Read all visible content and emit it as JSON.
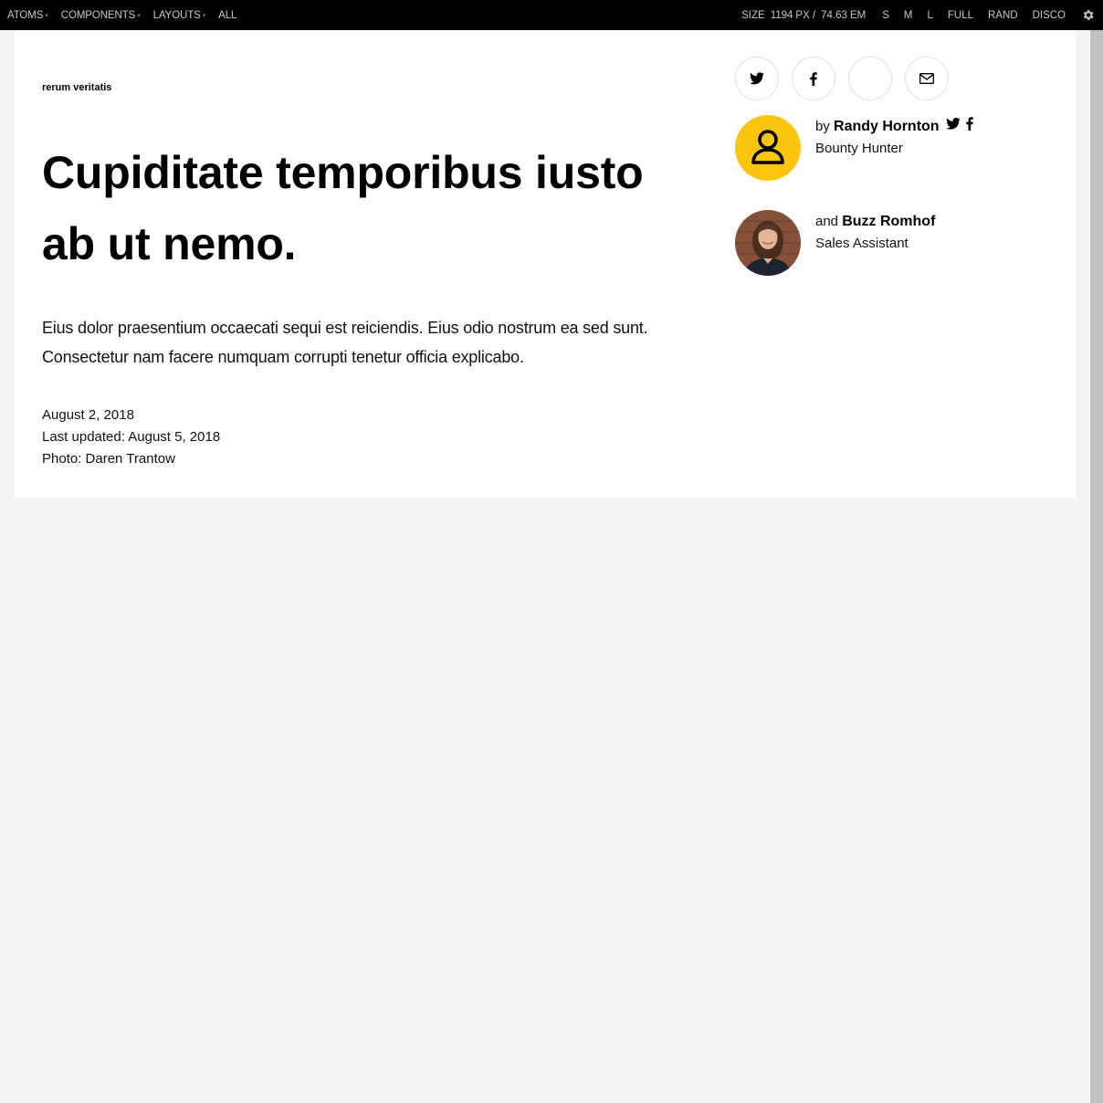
{
  "toolbar": {
    "nav": [
      {
        "label": "ATOMS",
        "caret": "▾"
      },
      {
        "label": "COMPONENTS",
        "caret": "▾"
      },
      {
        "label": "LAYOUTS",
        "caret": "▾"
      },
      {
        "label": "ALL",
        "caret": ""
      }
    ],
    "size_label": "SIZE",
    "size_px": "1194",
    "size_px_unit": "PX /",
    "size_em": "74.63",
    "size_em_unit": "EM",
    "viewports": [
      "S",
      "M",
      "L",
      "FULL",
      "RAND",
      "DISCO"
    ],
    "gear_icon": "gear-icon"
  },
  "article": {
    "kicker": "rerum veritatis",
    "headline": "Cupiditate temporibus iusto ab ut nemo.",
    "dek": "Eius dolor praesentium occaecati sequi est reiciendis. Eius odio nostrum ea sed sunt. Consectetur nam facere numquam corrupti tenetur officia explicabo.",
    "date": "August 2, 2018",
    "updated": "Last updated: August 5, 2018",
    "photo_credit": "Photo: Daren Trantow"
  },
  "share": [
    {
      "icon": "twitter-icon"
    },
    {
      "icon": "facebook-icon"
    },
    {
      "icon": "blank"
    },
    {
      "icon": "email-icon"
    }
  ],
  "authors": [
    {
      "prefix": "by",
      "name": "Randy Hornton",
      "title": "Bounty Hunter",
      "avatar": "person-placeholder-icon",
      "avatar_color": "#fcc50d"
    },
    {
      "prefix": "and",
      "name": "Buzz Romhof",
      "title": "Sales Assistant",
      "avatar": "author-photo"
    }
  ]
}
